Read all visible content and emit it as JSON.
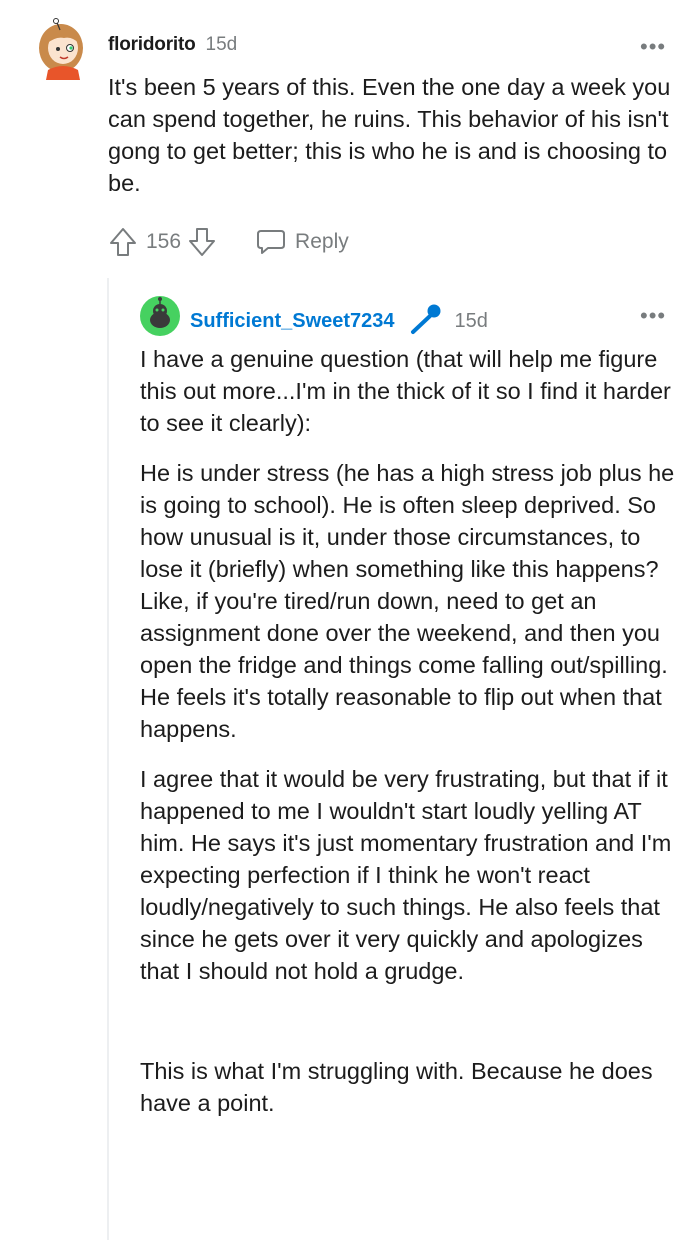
{
  "comment": {
    "username": "floridorito",
    "age": "15d",
    "more": "•••",
    "body": "It's been 5 years of this. Even the one day a week you can spend together, he ruins. This behavior of his isn't gong to get better; this is who he is and is choosing to be.",
    "vote_count": "156",
    "reply_label": "Reply"
  },
  "reply": {
    "username": "Sufficient_Sweet7234",
    "age": "15d",
    "more": "•••",
    "paragraphs": [
      "I have a genuine question (that will help me figure this out more...I'm in the thick of it so I find it harder to see it clearly):",
      "He is under stress (he has a high stress job plus he is going to school). He is often sleep deprived. So how unusual is it, under those circumstances, to lose it (briefly) when something like this happens? Like, if you're tired/run down, need to get an assignment done over the weekend, and then you open the fridge and things come falling out/spilling. He feels it's totally reasonable to flip out when that happens.",
      "I agree that it would be very frustrating, but that if it happened to me I wouldn't start loudly yelling AT him. He says it's just momentary frustration and I'm expecting perfection if I think he won't react loudly/negatively to such things. He also feels that since he gets over it very quickly and apologizes that I should not hold a grudge.",
      "This is what I'm struggling with. Because he does have a point."
    ]
  },
  "colors": {
    "link_blue": "#0079d3",
    "meta_gray": "#787c7e",
    "avatar_green": "#46d160",
    "mic_blue": "#0079d3"
  },
  "icons": {
    "upvote": "arrow-up-icon",
    "downvote": "arrow-down-icon",
    "reply": "speech-bubble-icon",
    "badge": "microphone-icon",
    "more": "ellipsis-icon"
  }
}
